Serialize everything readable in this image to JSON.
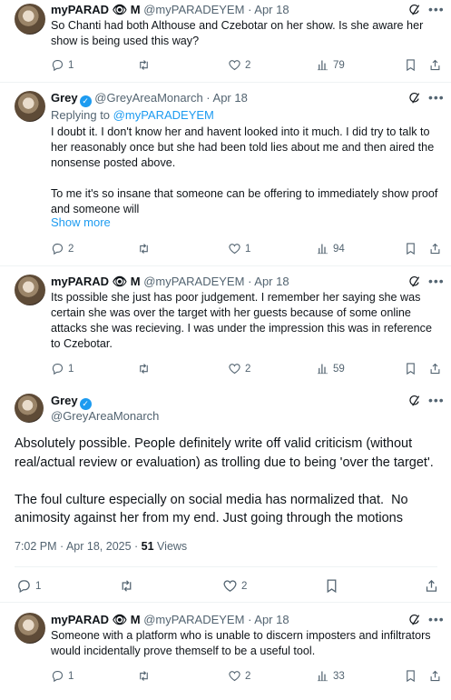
{
  "tweets": [
    {
      "author": "myPARAD 👁 M",
      "handle": "@myPARADEYEM",
      "date": "· Apr 18",
      "text": "So Chanti had both Althouse and Czebotar on her show. Is she aware her show is being used this way?",
      "replies": "1",
      "likes": "2",
      "views": "79"
    },
    {
      "author": "Grey",
      "handle": "@GreyAreaMonarch",
      "date": "· Apr 18",
      "replying_label": "Replying to",
      "replying_to": "@myPARADEYEM",
      "text": "I doubt it. I don't know her and havent looked into it much. I did try to talk to her reasonably once but she had been told lies about me and then aired the nonsense posted above.\n\nTo me it's so insane that someone can be offering to immediately show proof and someone will",
      "show_more": "Show more",
      "replies": "2",
      "likes": "1",
      "views": "94"
    },
    {
      "author": "myPARAD 👁 M",
      "handle": "@myPARADEYEM",
      "date": "· Apr 18",
      "text": "Its possible she just has poor judgement. I remember her saying she was certain she was over the target with her guests because of some online attacks she was recieving. I was under the impression this was in reference to Czebotar.",
      "replies": "1",
      "likes": "2",
      "views": "59"
    },
    {
      "author": "Grey",
      "handle": "@GreyAreaMonarch",
      "text": "Absolutely possible. People definitely write off valid criticism (without real/actual review or evaluation) as trolling due to being 'over the target'.\n\nThe foul culture especially on social media has normalized that.  No animosity against her from my end. Just going through the motions",
      "timestamp": "7:02 PM · Apr 18, 2025 · ",
      "views_count": "51",
      "views_label": " Views",
      "replies": "1",
      "likes": "2"
    },
    {
      "author": "myPARAD 👁 M",
      "handle": "@myPARADEYEM",
      "date": "· Apr 18",
      "text": "Someone with a platform who is unable to discern imposters and infiltrators would incidentally prove themself to be a useful tool.",
      "replies": "1",
      "likes": "2",
      "views": "33"
    }
  ],
  "colors": {
    "accent": "#1d9bf0",
    "muted": "#536471",
    "divider": "#eff3f4"
  },
  "icons": [
    "reply-icon",
    "retweet-icon",
    "like-icon",
    "views-icon",
    "bookmark-icon",
    "share-icon",
    "grok-icon",
    "more-icon",
    "verified-icon"
  ]
}
